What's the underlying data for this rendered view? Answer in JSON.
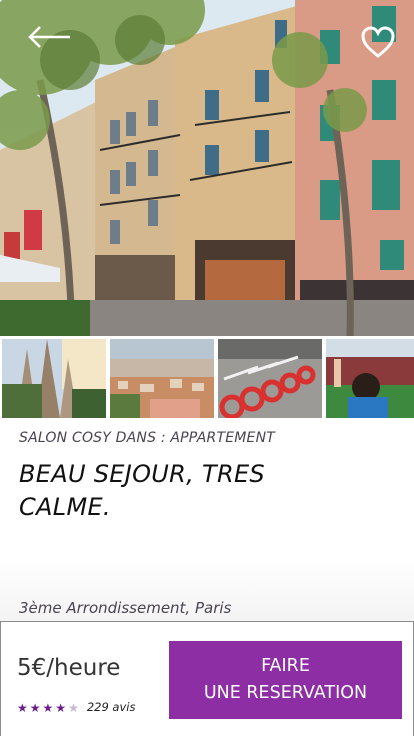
{
  "listing": {
    "category": "SALON COSY DANS : APPARTEMENT",
    "title": "BEAU SEJOUR, TRES CALME.",
    "location": "3ème Arrondissement, Paris"
  },
  "thumbnails": [
    {
      "name": "cathedral-photo"
    },
    {
      "name": "city-view-photo"
    },
    {
      "name": "bicycles-photo"
    },
    {
      "name": "stadium-fan-photo"
    }
  ],
  "booking": {
    "price": "5€/heure",
    "rating": 4,
    "rating_max": 5,
    "reviews": "229 avis",
    "button_line1": "FAIRE",
    "button_line2": "UNE RESERVATION"
  },
  "colors": {
    "accent": "#8e2ea4",
    "star_filled": "#6b1f87",
    "star_empty": "#c9b7d4"
  },
  "icons": {
    "back": "back-arrow-icon",
    "favorite": "heart-icon",
    "star": "star-icon"
  }
}
